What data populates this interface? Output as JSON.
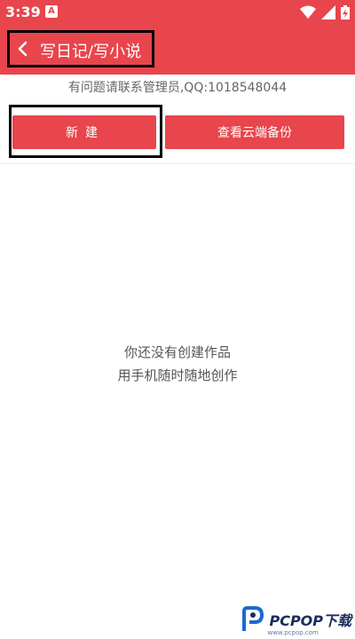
{
  "status": {
    "time": "3:39",
    "a_label": "A"
  },
  "appbar": {
    "title": "写日记/写小说"
  },
  "notice": {
    "text": "有问题请联系管理员,QQ:1018548044"
  },
  "buttons": {
    "new_label": "新建",
    "backup_label": "查看云端备份"
  },
  "empty_state": {
    "line1": "你还没有创建作品",
    "line2": "用手机随时随地创作"
  },
  "watermark": {
    "brand": "PCPOP下载",
    "sub": "www.pcpop.com"
  },
  "colors": {
    "accent": "#e8454c"
  }
}
